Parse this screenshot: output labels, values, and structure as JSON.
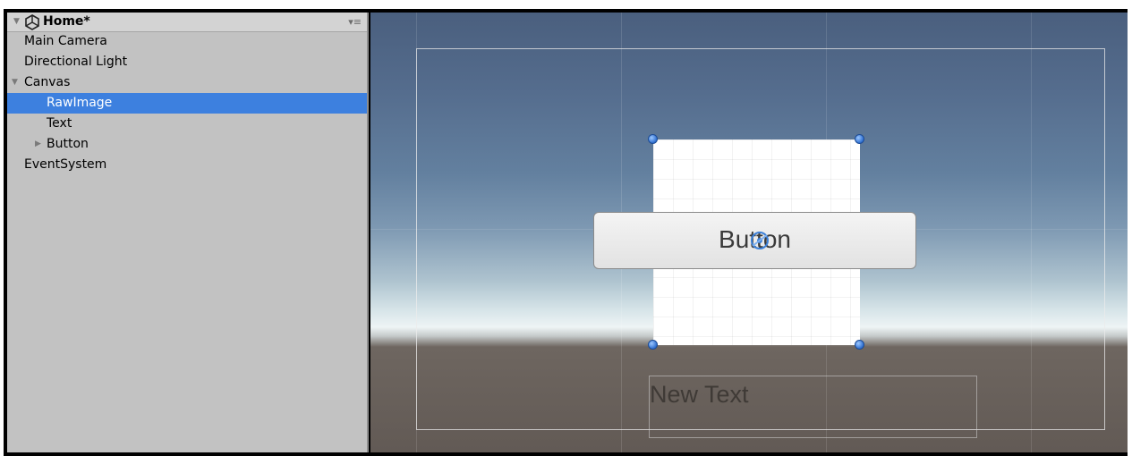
{
  "hierarchy": {
    "scene_name": "Home*",
    "items": [
      {
        "label": "Main Camera"
      },
      {
        "label": "Directional Light"
      },
      {
        "label": "Canvas"
      },
      {
        "label": "RawImage"
      },
      {
        "label": "Text"
      },
      {
        "label": "Button"
      },
      {
        "label": "EventSystem"
      }
    ],
    "selected_item": "RawImage"
  },
  "scene": {
    "button_text": "Button",
    "text_label": "New Text"
  },
  "colors": {
    "selection": "#3d80df",
    "panel_bg": "#c2c2c2",
    "handle": "#2f6fd0"
  }
}
